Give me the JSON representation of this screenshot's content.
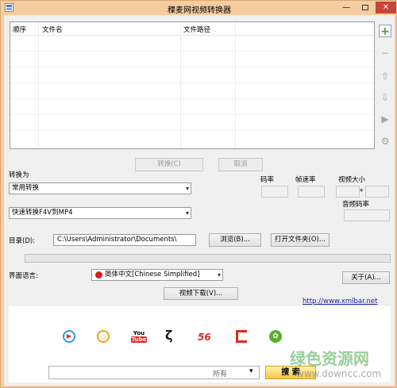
{
  "window": {
    "title": "稞麦网视频转换器"
  },
  "file_table": {
    "columns": [
      "顺序",
      "文件名",
      "文件路径"
    ],
    "rows": []
  },
  "actions": {
    "convert": "转换(C)",
    "cancel": "取消"
  },
  "convert_to": {
    "label": "转换为",
    "category": "常用转换",
    "preset": "快速转换F4V到MP4"
  },
  "params": {
    "bitrate": "码率",
    "framerate": "帧速率",
    "video_size": "视频大小",
    "size_sep": "*",
    "audio_bitrate": "音频码率"
  },
  "directory": {
    "label": "目录(D):",
    "path": "C:\\Users\\Administrator\\Documents\\",
    "browse": "浏览(B)...",
    "open_folder": "打开文件夹(O)..."
  },
  "progress": {
    "value": 0
  },
  "language": {
    "label": "界面语言:",
    "selected": "简体中文[Chinese Simplified]",
    "about": "关于(A)..."
  },
  "video_download": "视频下载(V)...",
  "website_link": "http://www.xmlbar.net",
  "video_sites": {
    "icons": [
      "play-icon",
      "smiley-icon",
      "youtube-logo",
      "youku-logo",
      "56-logo",
      "letv-logo",
      "leaf-logo"
    ],
    "youtube_top": "You",
    "youtube_bottom": "Tube",
    "site56": "56",
    "search_scope": "所有",
    "search_button": "搜 索"
  },
  "watermark": {
    "line1": "绿色资源网",
    "line2": "www.downcc.com"
  },
  "colors": {
    "titlebar": "#f6cda0",
    "client": "#f0f0f0",
    "add": "#3aa53a",
    "link": "#1a1aa8"
  }
}
